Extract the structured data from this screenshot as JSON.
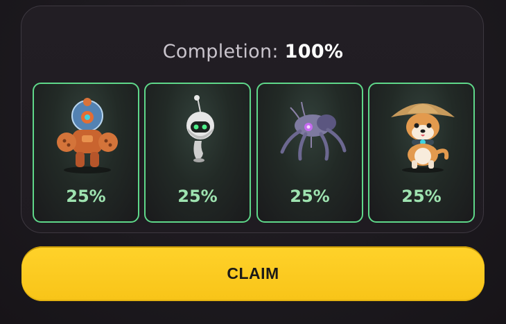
{
  "completion": {
    "label": "Completion:",
    "value": "100%"
  },
  "cards": [
    {
      "name": "orange-robot",
      "icon": "orange-armored-robot-icon",
      "percent": "25%"
    },
    {
      "name": "white-drone",
      "icon": "white-antenna-drone-icon",
      "percent": "25%"
    },
    {
      "name": "spider-bot",
      "icon": "purple-spider-robot-icon",
      "percent": "25%"
    },
    {
      "name": "shiba-dog",
      "icon": "shiba-dog-straw-hat-icon",
      "percent": "25%"
    }
  ],
  "claim_label": "CLAIM",
  "colors": {
    "card_border": "#5fd88a",
    "percent_text": "#9ee3b0",
    "claim_button": "#ffd22a",
    "background": "#1d1a1f"
  }
}
